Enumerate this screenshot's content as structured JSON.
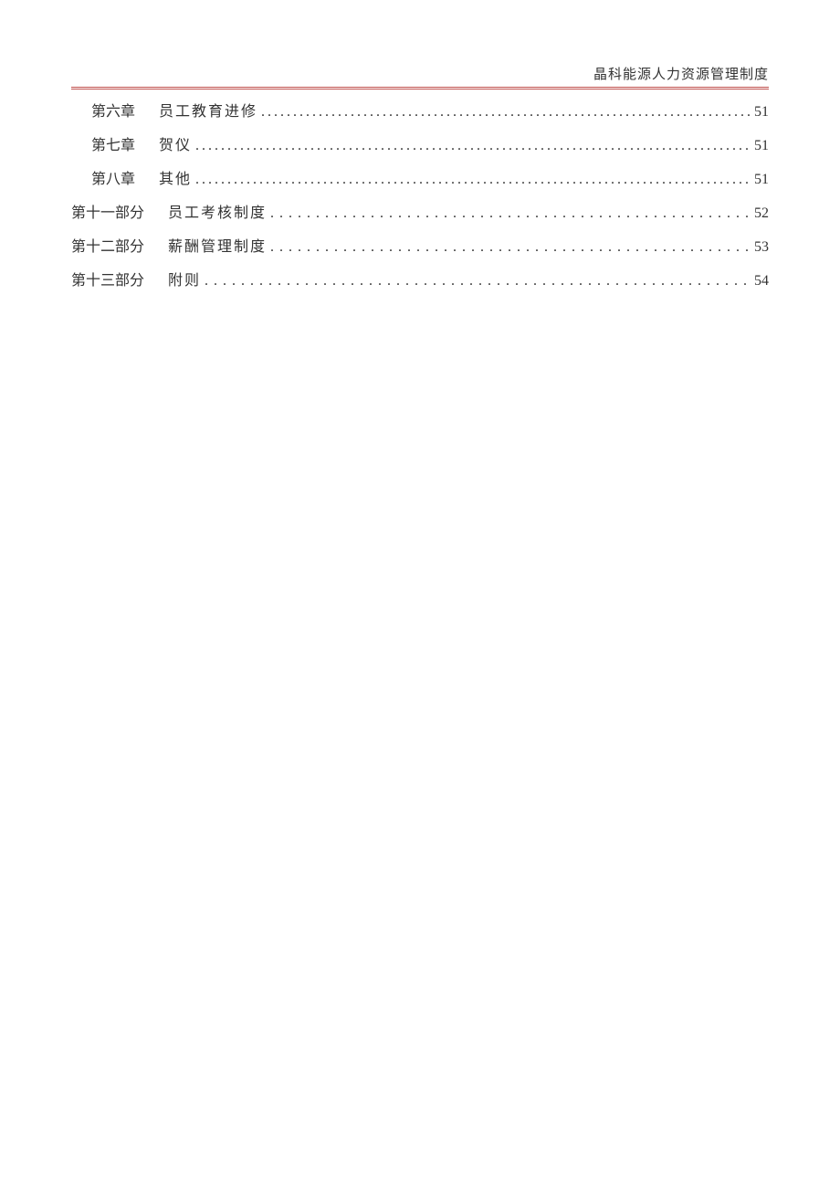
{
  "header": {
    "title": "晶科能源人力资源管理制度"
  },
  "toc": {
    "entries": [
      {
        "type": "chapter",
        "label": "第六章",
        "title": "员工教育进修",
        "page": "51"
      },
      {
        "type": "chapter",
        "label": "第七章",
        "title": "贺仪",
        "page": "51"
      },
      {
        "type": "chapter",
        "label": "第八章",
        "title": "其他",
        "page": "51"
      },
      {
        "type": "part",
        "label": "第十一部分",
        "title": "员工考核制度",
        "page": "52"
      },
      {
        "type": "part",
        "label": "第十二部分",
        "title": "薪酬管理制度",
        "page": "53"
      },
      {
        "type": "part",
        "label": "第十三部分",
        "title": "附则",
        "page": "54"
      }
    ]
  }
}
